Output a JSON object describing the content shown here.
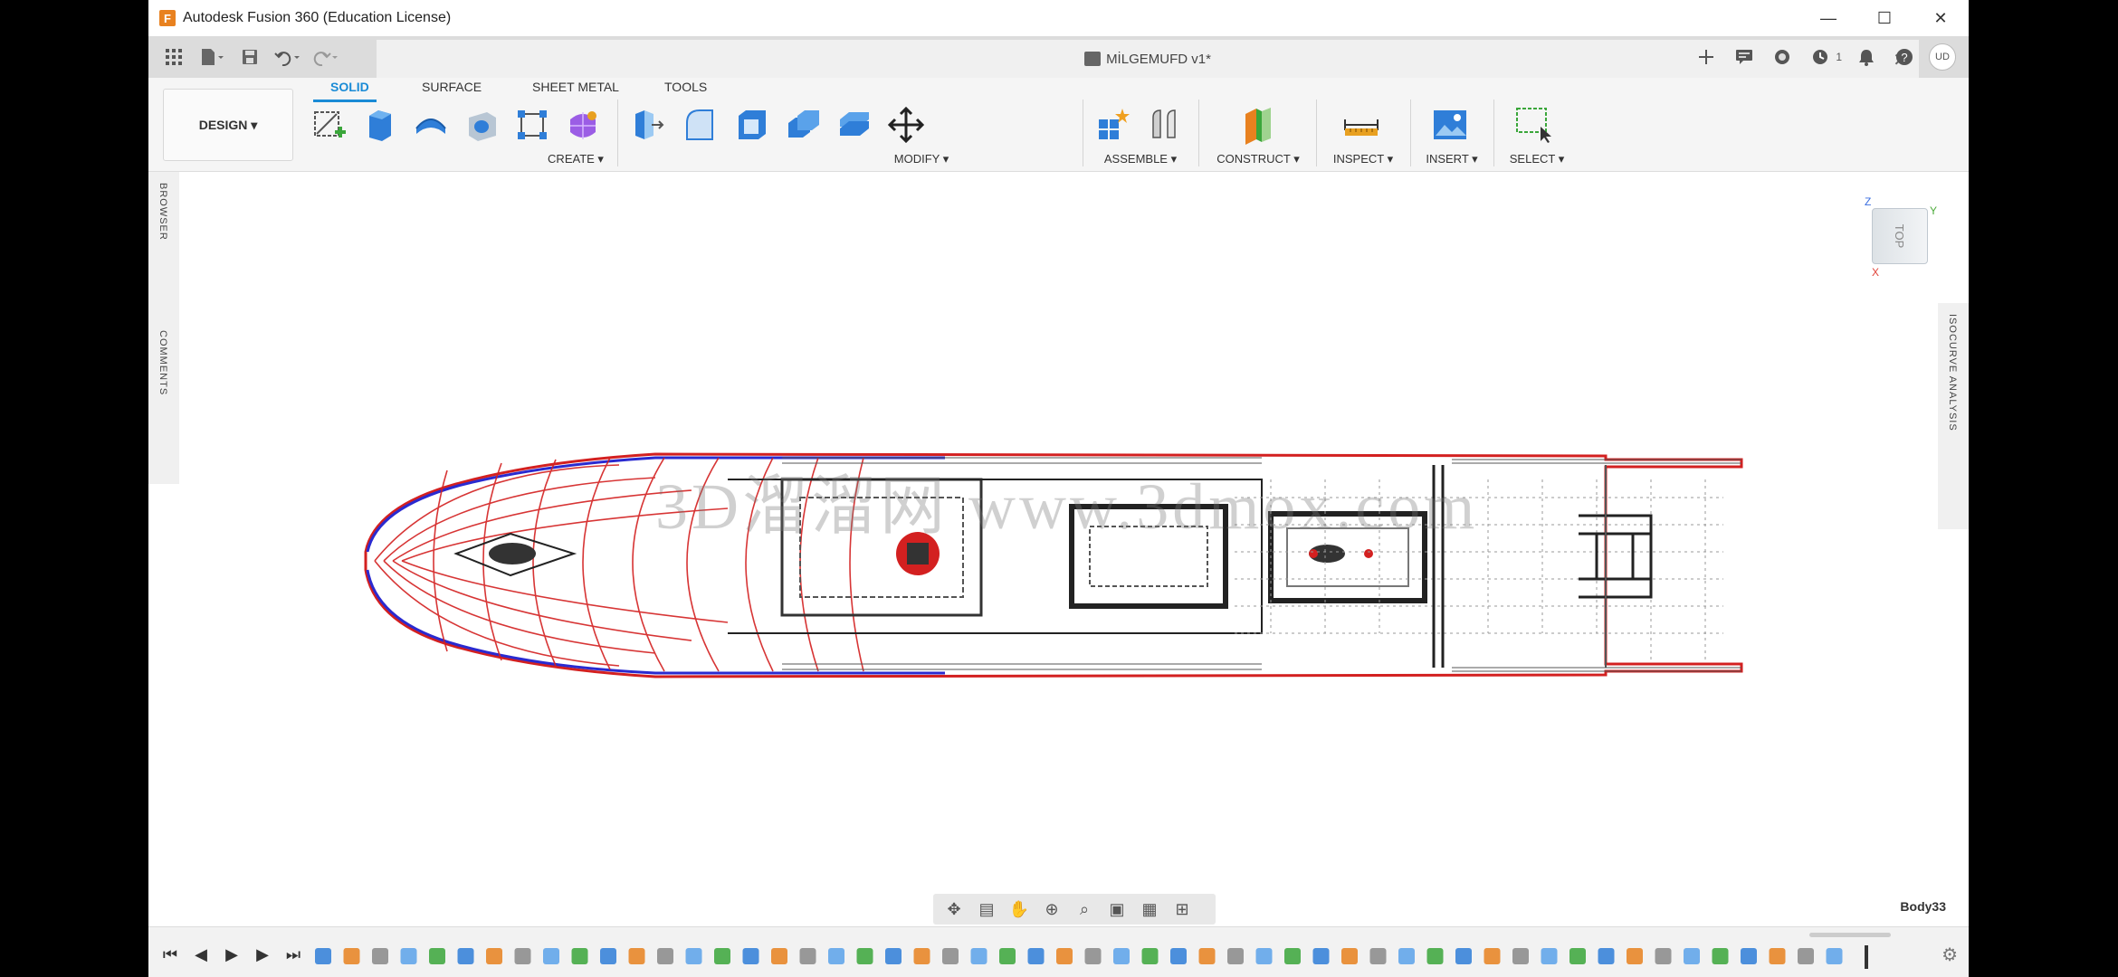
{
  "window": {
    "app_title": "Autodesk Fusion 360 (Education License)",
    "minimize": "—",
    "maximize": "☐",
    "close": "✕"
  },
  "document": {
    "title": "MİLGEMUFD v1*",
    "close": "✕"
  },
  "quick_access": {
    "version_count": "1",
    "user_initials": "UD"
  },
  "ribbon": {
    "workspace": "DESIGN ▾",
    "tabs": [
      "SOLID",
      "SURFACE",
      "SHEET METAL",
      "TOOLS"
    ],
    "groups": {
      "create": "CREATE ▾",
      "modify": "MODIFY ▾",
      "assemble": "ASSEMBLE ▾",
      "construct": "CONSTRUCT ▾",
      "inspect": "INSPECT ▾",
      "insert": "INSERT ▾",
      "select": "SELECT ▾"
    }
  },
  "side_panels": {
    "browser": "BROWSER",
    "comments": "COMMENTS",
    "isocurve": "ISOCURVE ANALYSIS"
  },
  "viewcube": {
    "face": "TOP",
    "axis_z": "Z",
    "axis_y": "Y",
    "axis_x": "X"
  },
  "watermark": "3D溜溜网 www.3dmox.com",
  "status": {
    "selection": "Body33"
  },
  "colors": {
    "accent": "#1a8bd6",
    "hull_red": "#d32020",
    "hull_blue": "#2a2ad0"
  },
  "icons": {
    "create": [
      "sketch-icon",
      "extrude-icon",
      "revolve-icon",
      "hole-icon",
      "pattern-icon",
      "form-icon"
    ],
    "modify": [
      "press-pull-icon",
      "fillet-icon",
      "shell-icon",
      "combine-icon",
      "offset-face-icon",
      "move-icon"
    ],
    "assemble": [
      "new-component-icon",
      "joint-icon"
    ],
    "construct": [
      "plane-icon"
    ],
    "inspect": [
      "measure-icon"
    ],
    "insert": [
      "image-icon"
    ],
    "select": [
      "select-box-icon"
    ]
  }
}
